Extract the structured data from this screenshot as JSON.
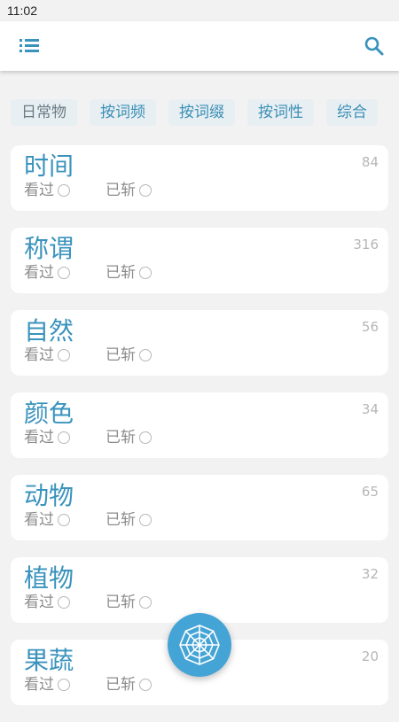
{
  "status_bar": {
    "time": "11:02"
  },
  "colors": {
    "accent": "#3a93bd",
    "tab_bg": "#e8eff3",
    "fab": "#45a4d6",
    "background": "#f2f2f2"
  },
  "app_bar": {
    "menu_icon": "menu-list-icon",
    "search_icon": "search-icon"
  },
  "tabs": [
    {
      "label": "日常物",
      "active": false
    },
    {
      "label": "按词频",
      "active": true
    },
    {
      "label": "按词缀",
      "active": true
    },
    {
      "label": "按词性",
      "active": true
    },
    {
      "label": "综合",
      "active": true
    }
  ],
  "categories": [
    {
      "title": "时间",
      "count": "84",
      "seen_label": "看过",
      "done_label": "已斩"
    },
    {
      "title": "称谓",
      "count": "316",
      "seen_label": "看过",
      "done_label": "已斩"
    },
    {
      "title": "自然",
      "count": "56",
      "seen_label": "看过",
      "done_label": "已斩"
    },
    {
      "title": "颜色",
      "count": "34",
      "seen_label": "看过",
      "done_label": "已斩"
    },
    {
      "title": "动物",
      "count": "65",
      "seen_label": "看过",
      "done_label": "已斩"
    },
    {
      "title": "植物",
      "count": "32",
      "seen_label": "看过",
      "done_label": "已斩"
    },
    {
      "title": "果蔬",
      "count": "20",
      "seen_label": "看过",
      "done_label": "已斩"
    }
  ],
  "fab": {
    "icon": "web-icon"
  }
}
